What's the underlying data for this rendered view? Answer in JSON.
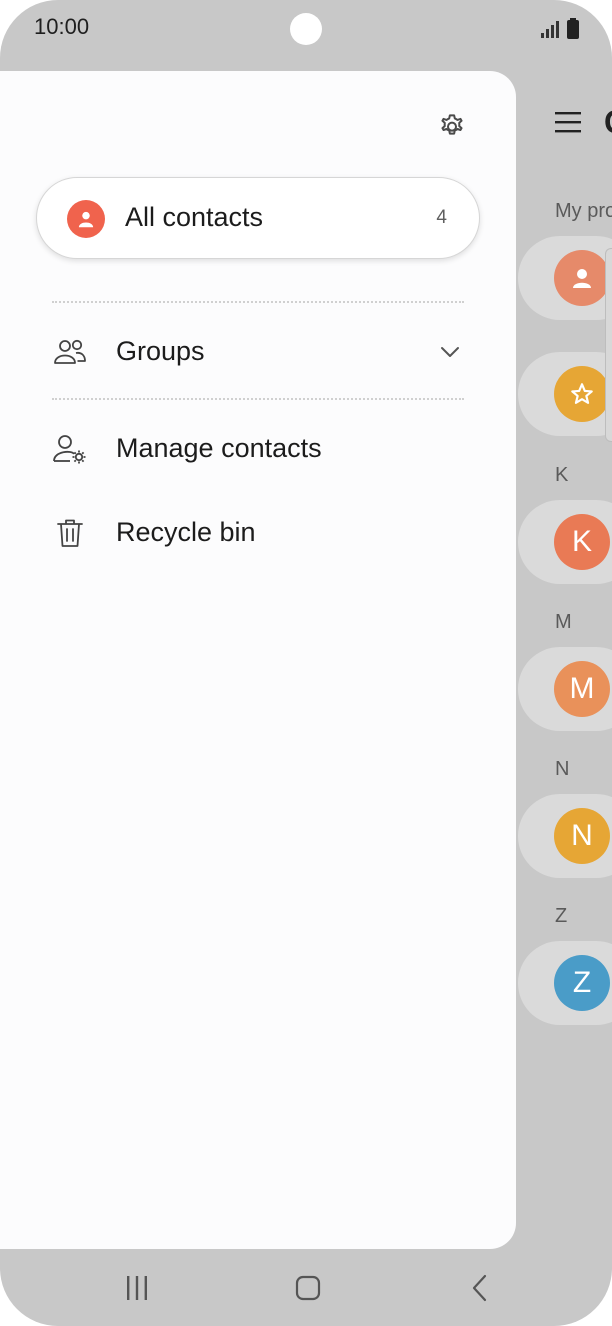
{
  "status_bar": {
    "time": "10:00",
    "icons": [
      "signal-icon",
      "battery-icon"
    ]
  },
  "drawer": {
    "settings_icon": "gear-icon",
    "all_contacts": {
      "label": "All contacts",
      "count": "4",
      "icon": "person-icon",
      "color": "#f0634d"
    },
    "items": [
      {
        "label": "Groups",
        "icon": "groups-icon",
        "expandable": true
      },
      {
        "label": "Manage contacts",
        "icon": "manage-contacts-icon"
      },
      {
        "label": "Recycle bin",
        "icon": "trash-icon"
      }
    ]
  },
  "background_list": {
    "title_fragment": "C",
    "my_profile_label": "My pro",
    "sections": [
      {
        "letter": "K",
        "initial": "K",
        "color": "#e97a55"
      },
      {
        "letter": "M",
        "initial": "M",
        "color": "#e9915a"
      },
      {
        "letter": "N",
        "initial": "N",
        "color": "#e6a635"
      },
      {
        "letter": "Z",
        "initial": "Z",
        "color": "#4a9cc8"
      }
    ],
    "profile_color": "#e68a6a",
    "favorites_color": "#e6a635"
  },
  "nav_bar": {
    "buttons": [
      "recent-apps-icon",
      "home-icon",
      "back-icon"
    ]
  }
}
